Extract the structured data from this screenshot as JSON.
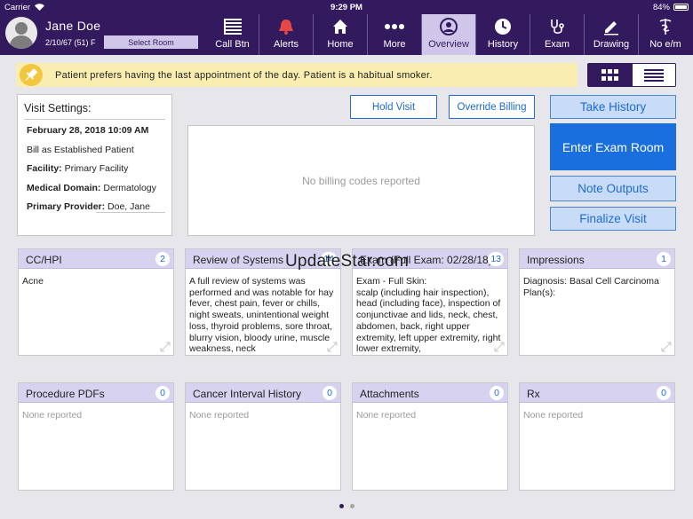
{
  "status_bar": {
    "carrier": "Carrier",
    "time": "9:29 PM",
    "battery": "84%",
    "battery_level": 0.84
  },
  "patient": {
    "name": "Jane Doe",
    "info": "2/10/67 (51) F",
    "select_room": "Select Room"
  },
  "nav": [
    {
      "label": "Call Btn",
      "icon": "call-button-icon"
    },
    {
      "label": "Alerts",
      "icon": "bell-alert-icon"
    },
    {
      "label": "Home",
      "icon": "house-icon"
    },
    {
      "label": "More",
      "icon": "more-dots-icon"
    },
    {
      "label": "Overview",
      "icon": "person-circle-icon",
      "active": true
    },
    {
      "label": "History",
      "icon": "clock-icon"
    },
    {
      "label": "Exam",
      "icon": "stethoscope-icon"
    },
    {
      "label": "Drawing",
      "icon": "pencil-icon"
    },
    {
      "label": "No e/m",
      "icon": "caduceus-icon"
    }
  ],
  "banner": {
    "text": "Patient prefers having the last appointment of the day. Patient is a habitual smoker.",
    "icon": "pin-icon"
  },
  "view_toggle": {
    "grid_icon": "grid-icon",
    "list_icon": "list-icon",
    "active": "grid"
  },
  "visit_settings": {
    "title": "Visit Settings:",
    "date": "February 28, 2018 10:09 AM",
    "bill_as": "Bill as Established Patient",
    "facility_label": "Facility:",
    "facility": "Primary Facility",
    "medical_domain_label": "Medical Domain:",
    "medical_domain": "Dermatology",
    "primary_provider_label": "Primary Provider:",
    "primary_provider": "Doe, Jane"
  },
  "buttons": {
    "hold_visit": "Hold Visit",
    "override_billing": "Override Billing",
    "take_history": "Take History",
    "enter_exam_room": "Enter Exam Room",
    "note_outputs": "Note Outputs",
    "finalize_visit": "Finalize Visit"
  },
  "billing": {
    "empty_text": "No billing codes reported"
  },
  "cards_row1": [
    {
      "title": "CC/HPI",
      "count": "2",
      "body": "Acne"
    },
    {
      "title": "Review of Systems",
      "count": "14",
      "body": "A full review of systems was performed and was notable for hay fever, chest pain, fever or chills, night sweats, unintentional weight loss, thyroid problems, sore throat, blurry vision, bloody urine, muscle weakness, neck"
    },
    {
      "title": "Exam (Full Exam: 02/28/18)",
      "count": "13",
      "body": "Exam - Full Skin:\nscalp (including hair inspection), head (including face), inspection of conjunctivae and lids, neck, chest, abdomen, back, right upper extremity, left upper extremity, right lower extremity,"
    },
    {
      "title": "Impressions",
      "count": "1",
      "body": "Diagnosis: Basal Cell Carcinoma\nPlan(s):"
    }
  ],
  "cards_row2": [
    {
      "title": "Procedure PDFs",
      "count": "0",
      "body": "None reported"
    },
    {
      "title": "Cancer Interval History",
      "count": "0",
      "body": "None reported"
    },
    {
      "title": "Attachments",
      "count": "0",
      "body": "None reported"
    },
    {
      "title": "Rx",
      "count": "0",
      "body": "None reported"
    }
  ],
  "watermark": "UpdateStar.com",
  "pager": {
    "pages": 2,
    "current": 1
  },
  "colors": {
    "header": "#331a5e",
    "accent": "#1d6ad6",
    "card_header": "#d7d2f0",
    "banner": "#f9eeb0"
  }
}
